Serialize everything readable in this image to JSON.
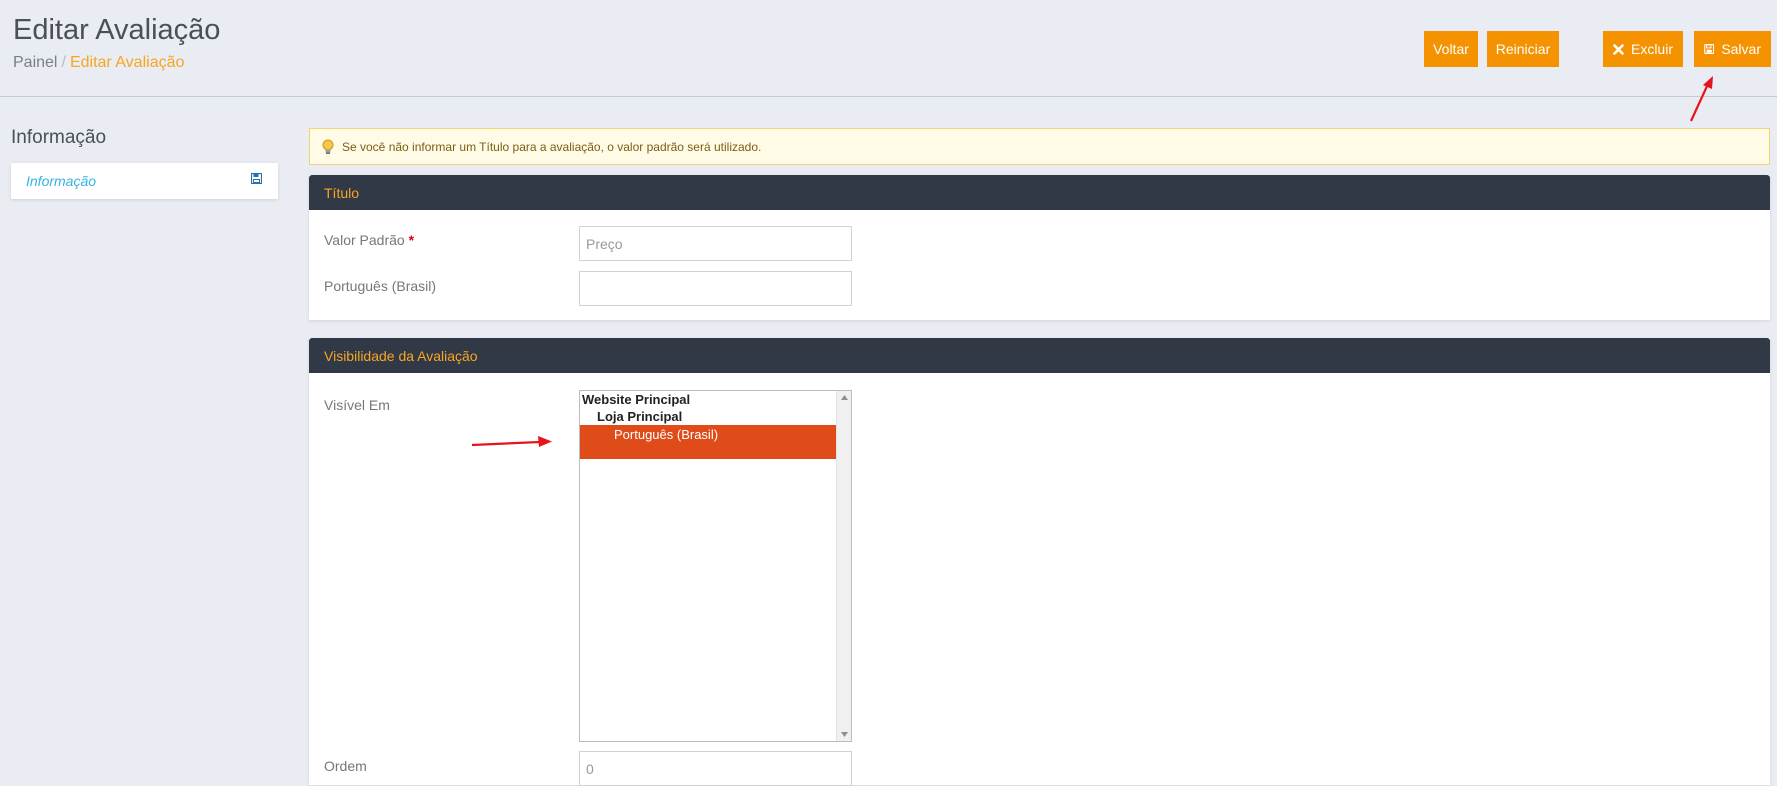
{
  "header": {
    "title": "Editar Avaliação",
    "breadcrumb": {
      "root": "Painel",
      "separator": "/",
      "current": "Editar Avaliação"
    }
  },
  "toolbar": {
    "back_label": "Voltar",
    "reset_label": "Reiniciar",
    "delete_label": "Excluir",
    "save_label": "Salvar",
    "accent_color": "#f59200"
  },
  "sidebar": {
    "title": "Informação",
    "items": [
      {
        "label": "Informação",
        "icon": "save-icon"
      }
    ]
  },
  "alert": {
    "icon": "lightbulb-icon",
    "text": "Se você não informar um Título para a avaliação, o valor padrão será utilizado."
  },
  "title_panel": {
    "heading": "Título",
    "default_label": "Valor Padrão",
    "required_mark": "*",
    "default_placeholder": "Preço",
    "default_value": "",
    "pt_br_label": "Português (Brasil)",
    "pt_br_value": ""
  },
  "visibility_panel": {
    "heading": "Visibilidade da Avaliação",
    "visible_in_label": "Visível Em",
    "tree": {
      "website": "Website Principal",
      "store": "Loja Principal",
      "store_view": "Português (Brasil)",
      "selected": "Português (Brasil)"
    },
    "order_label": "Ordem",
    "order_placeholder": "0"
  },
  "colors": {
    "panel_heading_bg": "#323946",
    "panel_heading_text": "#f5a623",
    "selected_option_bg": "#e04b1a",
    "sidebar_link": "#36b3e2",
    "annotation_arrow": "#e8141b"
  }
}
